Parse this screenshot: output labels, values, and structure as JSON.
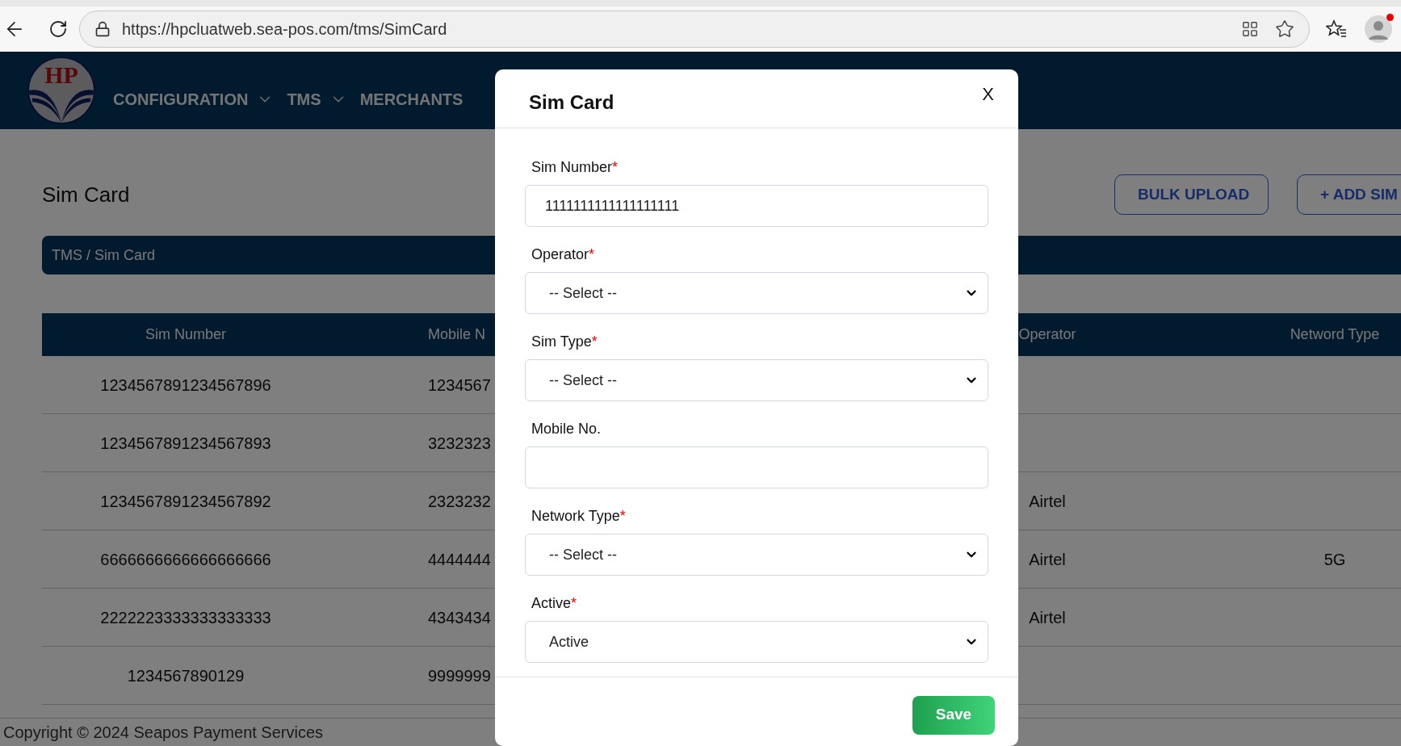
{
  "browser": {
    "url": "https://hpcluatweb.sea-pos.com/tms/SimCard"
  },
  "nav": {
    "logo_text": "HP",
    "items": [
      {
        "label": "CONFIGURATION",
        "dropdown": true
      },
      {
        "label": "TMS",
        "dropdown": true
      },
      {
        "label": "MERCHANTS",
        "dropdown": false
      }
    ]
  },
  "page": {
    "title": "Sim Card",
    "buttons": [
      "BULK UPLOAD",
      "+ ADD SIM"
    ],
    "breadcrumb": "TMS / Sim Card"
  },
  "table": {
    "columns": [
      "Sim Number",
      "Mobile N",
      "Operator",
      "Netword Type"
    ],
    "rows": [
      {
        "sim_number": "1234567891234567896",
        "mobile": "1234567"
      },
      {
        "sim_number": "1234567891234567893",
        "mobile": "3232323"
      },
      {
        "sim_number": "1234567891234567892",
        "mobile": "2323232",
        "operator": "Airtel"
      },
      {
        "sim_number": "6666666666666666666",
        "mobile": "4444444",
        "operator": "Airtel",
        "network_type": "5G"
      },
      {
        "sim_number": "2222223333333333333",
        "mobile": "4343434",
        "operator": "Airtel"
      },
      {
        "sim_number": "1234567890129",
        "mobile": "9999999"
      }
    ]
  },
  "footer": "Copyright © 2024 Seapos Payment Services",
  "modal": {
    "title": "Sim Card",
    "close": "X",
    "fields": [
      {
        "kind": "text",
        "label": "Sim Number",
        "required": true,
        "value": "1111111111111111111"
      },
      {
        "kind": "select",
        "label": "Operator",
        "required": true,
        "value": "-- Select --"
      },
      {
        "kind": "select",
        "label": "Sim Type",
        "required": true,
        "value": "-- Select --"
      },
      {
        "kind": "text",
        "label": "Mobile No.",
        "required": false
      },
      {
        "kind": "select",
        "label": "Network Type",
        "required": true,
        "value": "-- Select --"
      },
      {
        "kind": "select",
        "label": "Active",
        "required": true,
        "value": "Active"
      }
    ],
    "required_mark": "*",
    "save": "Save"
  }
}
